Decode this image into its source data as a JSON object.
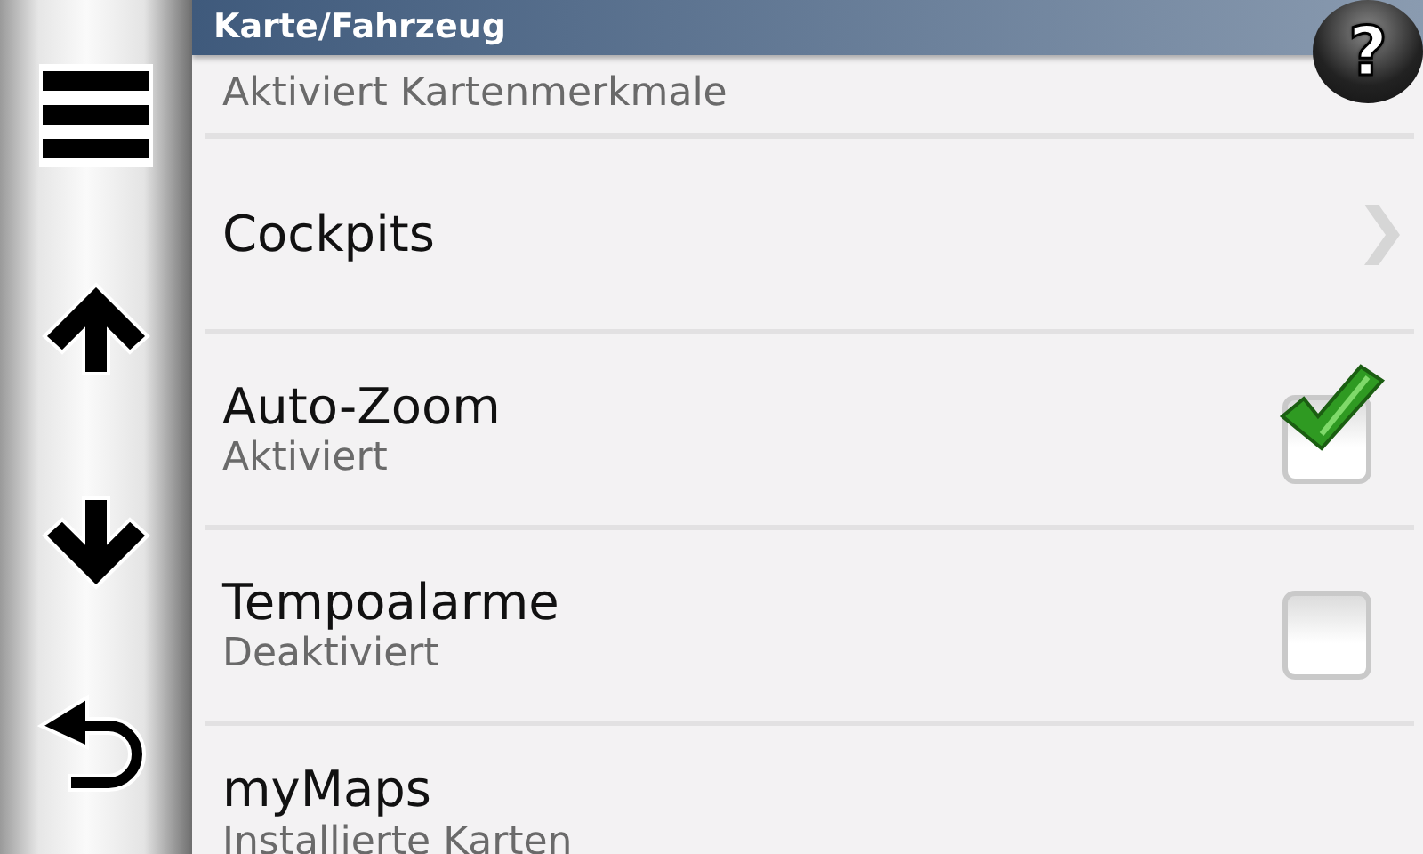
{
  "window": {
    "title": "Karte/Fahrzeug"
  },
  "help_button": {
    "label": "?"
  },
  "rows": [
    {
      "kind": "partial",
      "subtitle": "Aktiviert Kartenmerkmale"
    },
    {
      "kind": "link",
      "label": "Cockpits"
    },
    {
      "kind": "toggle",
      "label": "Auto-Zoom",
      "subtitle": "Aktiviert",
      "checked": true
    },
    {
      "kind": "toggle",
      "label": "Tempoalarme",
      "subtitle": "Deaktiviert",
      "checked": false
    },
    {
      "kind": "partial_bottom",
      "label": "myMaps",
      "subtitle": "Installierte Karten"
    }
  ]
}
